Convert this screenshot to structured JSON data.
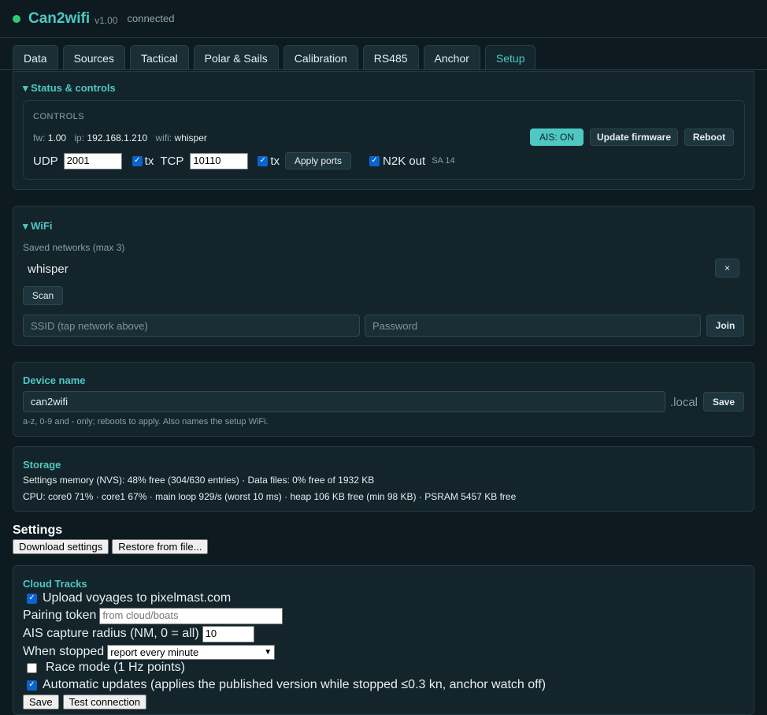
{
  "app": {
    "title": "Can2wifi",
    "version": "v1.00",
    "status": "connected",
    "status_color": "#2ecc71"
  },
  "tabs": [
    "Data",
    "Sources",
    "Tactical",
    "Polar & Sails",
    "Calibration",
    "RS485",
    "Anchor",
    "Setup"
  ],
  "active_tab": "Setup",
  "status": {
    "title": "▾ Status & controls",
    "controls_label": "CONTROLS",
    "fw_label": "fw:",
    "fw": "1.00",
    "ip_label": "ip:",
    "ip": "192.168.1.210",
    "wifi_label": "wifi:",
    "wifi": "whisper",
    "ais_button": "AIS: ON",
    "update_button": "Update firmware",
    "reboot_button": "Reboot",
    "udp_label": "UDP",
    "udp_value": "2001",
    "udp_tx_label": "tx",
    "udp_tx_checked": true,
    "tcp_label": "TCP",
    "tcp_value": "10110",
    "tcp_tx_label": "tx",
    "tcp_tx_checked": true,
    "apply_ports": "Apply ports",
    "n2k_label": "N2K out",
    "n2k_checked": true,
    "n2k_sa": "SA 14"
  },
  "wifi": {
    "title": "▾ WiFi",
    "saved_label": "Saved networks (max 3)",
    "networks": [
      "whisper"
    ],
    "remove_glyph": "×",
    "scan_button": "Scan",
    "ssid_placeholder": "SSID (tap network above)",
    "password_placeholder": "Password",
    "join_button": "Join"
  },
  "device": {
    "title": "Device name",
    "value": "can2wifi",
    "suffix": ".local",
    "save_button": "Save",
    "hint": "a-z, 0-9 and - only; reboots to apply. Also names the setup WiFi."
  },
  "storage": {
    "title": "Storage",
    "line1": "Settings memory (NVS): 48% free (304/630 entries) · Data files: 0% free of 1932 KB",
    "line2": "CPU: core0 71% · core1 67% · main loop 929/s (worst 10 ms) · heap 106 KB free (min 98 KB) · PSRAM 5457 KB free"
  },
  "settings": {
    "title": "Settings",
    "download_button": "Download settings",
    "restore_button": "Restore from file..."
  },
  "cloud": {
    "title": "Cloud Tracks",
    "upload_label": "Upload voyages to pixelmast.com",
    "upload_checked": true,
    "pairing_label": "Pairing token",
    "pairing_placeholder": "from cloud/boats",
    "ais_radius_label": "AIS capture radius (NM, 0 = all)",
    "ais_radius_value": "10",
    "stopped_label": "When stopped",
    "stopped_value": "report every minute",
    "race_label": "Race mode (1 Hz points)",
    "race_checked": false,
    "auto_label": "Automatic updates (applies the published version while stopped ≤0.3 kn, anchor watch off)",
    "auto_checked": true,
    "save_button": "Save",
    "test_button": "Test connection"
  },
  "colors": {
    "accent": "#4fc8c4",
    "background": "#0d1b20",
    "panel": "#13242a"
  }
}
